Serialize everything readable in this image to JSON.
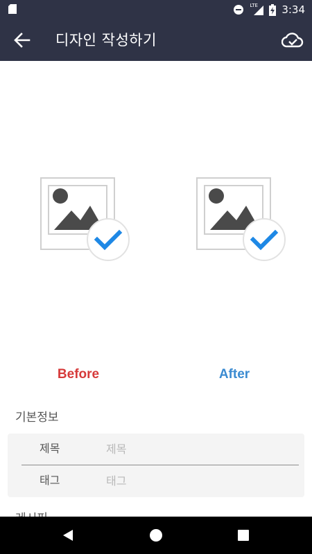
{
  "status_bar": {
    "network_label": "LTE",
    "time": "3:34"
  },
  "app_bar": {
    "title": "디자인 작성하기",
    "back_icon": "arrow-left-icon",
    "action_icon": "cloud-check-icon"
  },
  "images": {
    "before_caption": "Before",
    "after_caption": "After"
  },
  "basic_info": {
    "section_title": "기본정보",
    "title_label": "제목",
    "title_placeholder": "제목",
    "tag_label": "태그",
    "tag_placeholder": "태그"
  },
  "recipe": {
    "section_title": "레시피"
  },
  "colors": {
    "app_bar": "#2f3346",
    "before": "#d63a3a",
    "after": "#3b8bd1",
    "check": "#1e88e5"
  }
}
